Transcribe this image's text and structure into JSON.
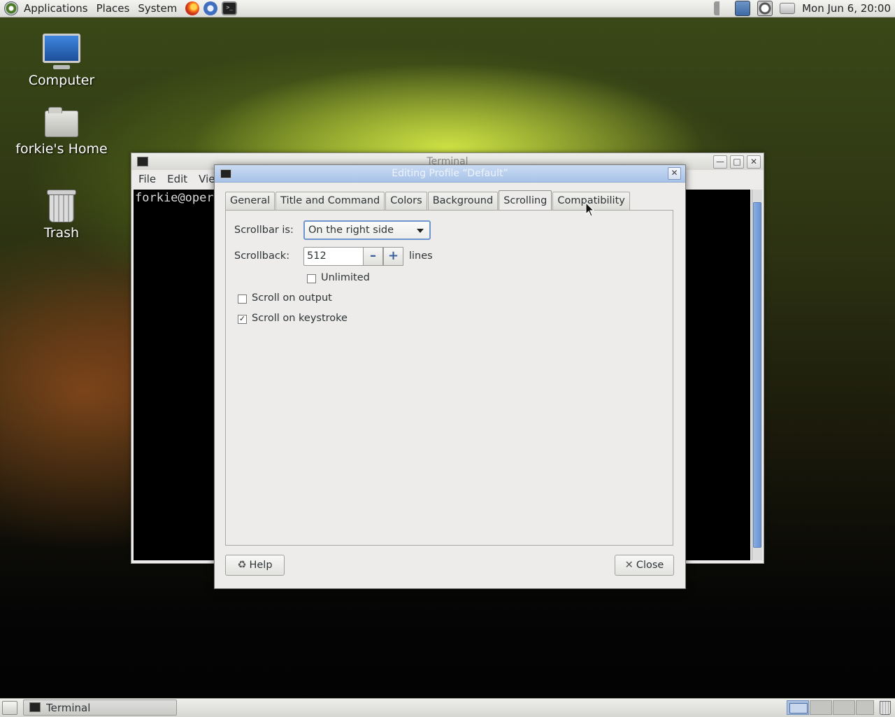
{
  "top_panel": {
    "menus": [
      "Applications",
      "Places",
      "System"
    ],
    "launchers": [
      "firefox-icon",
      "thunderbird-icon",
      "terminal-icon"
    ],
    "clock": "Mon Jun  6, 20:00"
  },
  "desktop": {
    "icons": [
      {
        "label": "Computer"
      },
      {
        "label": "forkie's Home"
      },
      {
        "label": "Trash"
      }
    ]
  },
  "terminal_window": {
    "title": "Terminal",
    "menu": [
      "File",
      "Edit",
      "View"
    ],
    "prompt": "forkie@oper"
  },
  "dialog": {
    "title": "Editing Profile “Default”",
    "tabs": [
      "General",
      "Title and Command",
      "Colors",
      "Background",
      "Scrolling",
      "Compatibility"
    ],
    "active_tab": "Scrolling",
    "scrollbar_label": "Scrollbar is:",
    "scrollbar_value": "On the right side",
    "scrollback_label": "Scrollback:",
    "scrollback_value": "512",
    "scrollback_unit": "lines",
    "unlimited_label": "Unlimited",
    "unlimited_checked": false,
    "scroll_on_output_label": "Scroll on output",
    "scroll_on_output_checked": false,
    "scroll_on_keystroke_label": "Scroll on keystroke",
    "scroll_on_keystroke_checked": true,
    "help_label": "Help",
    "close_label": "Close"
  },
  "taskbar": {
    "task_label": "Terminal"
  },
  "colors": {
    "title_active": "#a7c2e8",
    "focus_ring": "#6f95cf",
    "scroll_thumb": "#6a93d2"
  }
}
